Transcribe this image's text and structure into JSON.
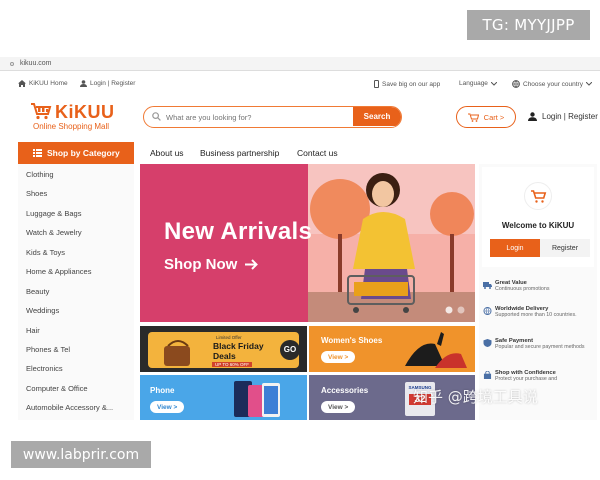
{
  "watermarks": {
    "tg": "TG: MYYJJPP",
    "site": "www.labprir.com",
    "zhihu": "知乎 @跨境工具说"
  },
  "address_bar": {
    "url": "kikuu.com"
  },
  "topbar": {
    "home": "KiKUU Home",
    "login_register": "Login | Register",
    "app": "Save big on our app",
    "language": "Language",
    "country": "Choose your country"
  },
  "header": {
    "logo_name": "KiKUU",
    "logo_subtitle": "Online Shopping Mall",
    "search_placeholder": "What are you looking for?",
    "search_button": "Search",
    "cart": "Cart >",
    "login_register": "Login | Register"
  },
  "nav": {
    "category_button": "Shop by Category",
    "links": [
      "About us",
      "Business partnership",
      "Contact us"
    ]
  },
  "categories": [
    "Clothing",
    "Shoes",
    "Luggage & Bags",
    "Watch & Jewelry",
    "Kids & Toys",
    "Home & Appliances",
    "Beauty",
    "Weddings",
    "Hair",
    "Phones & Tel",
    "Electronics",
    "Computer & Office",
    "Automobile Accessory &..."
  ],
  "banner": {
    "title": "New Arrivals",
    "cta": "Shop Now"
  },
  "tiles": {
    "black_friday": {
      "tag": "Limited Offer",
      "title_1": "Black Friday",
      "title_2": "Deals",
      "discount": "UP TO 60% OFF",
      "go": "GO"
    },
    "womens_shoes": {
      "title": "Women's Shoes",
      "view": "View >"
    },
    "phone": {
      "title": "Phone",
      "view": "View >"
    },
    "accessories": {
      "title": "Accessories",
      "view": "View >",
      "sd_brand": "SAMSUNG",
      "sd_size": "32"
    }
  },
  "welcome": {
    "title": "Welcome to KiKUU",
    "login": "Login",
    "register": "Register",
    "features": [
      {
        "title": "Great Value",
        "desc": "Continuous promotions",
        "icon": "truck-icon"
      },
      {
        "title": "Worldwide Delivery",
        "desc": "Supported more than 10 countries.",
        "icon": "globe-icon"
      },
      {
        "title": "Safe Payment",
        "desc": "Popular and secure payment methods",
        "icon": "shield-icon"
      },
      {
        "title": "Shop with Confidence",
        "desc": "Protect your purchase and",
        "icon": "shopping-bag-icon"
      }
    ]
  },
  "colors": {
    "brand": "#e8611a",
    "banner_bg": "#d63f6b",
    "accent_yellow": "#f3b33d"
  }
}
